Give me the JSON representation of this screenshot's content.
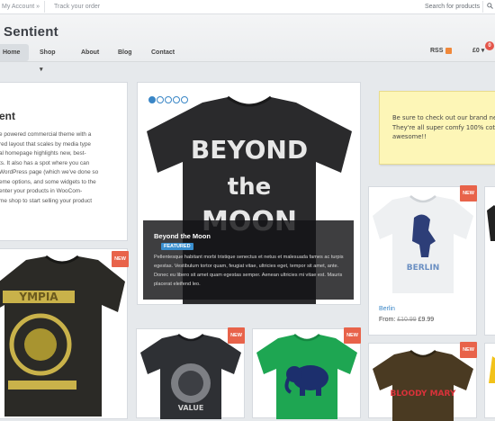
{
  "topbar": {
    "account": "My Account »",
    "track_order": "Track your order",
    "search_placeholder": "Search for products"
  },
  "header": {
    "logo": "Sentient",
    "nav": [
      {
        "label": "Home"
      },
      {
        "label": "Shop ▾"
      },
      {
        "label": "About"
      },
      {
        "label": "Blog"
      },
      {
        "label": "Contact"
      }
    ],
    "rss_label": "RSS",
    "cart_amount": "£0 ▾",
    "cart_count": "0"
  },
  "welcome": {
    "heading": "ent",
    "body": "e powered commercial theme with a\nred layout that scales by media type\nal homepage highlights new, best-\nts. It also has a spot where you can\nWordPress page (which we've done so\neme options, and some widgets to the\nenter your products in WooCom-\nme shop to start selling your product"
  },
  "featured": {
    "slide_count": 5,
    "active_slide": 1,
    "shirt_text": [
      "BEYOND",
      "the",
      "MOON"
    ],
    "title": "Beyond the Moon",
    "badge": "FEATURED",
    "text": "Pellentesque habitant morbi tristique senectus et netus et malesuada fames ac turpis egestas. Vestibulum tortor quam, feugiat vitae, ultricies eget, tempor sit amet, ante. Donec eu libero sit amet quam egestas semper. Aenean ultricies mi vitae est. Mauris placerat eleifend leo."
  },
  "note": {
    "text": "Be sure to check out our brand new\nThey're all super comfy 100% cotton\nawesome!!"
  },
  "products": {
    "new_label": "NEW",
    "berlin": {
      "name": "Berlin",
      "price_prefix": "From:",
      "old_price": "£10.99",
      "price": "£9.99",
      "shirt_text": "BERLIN"
    },
    "olympia_text": "YMPIA",
    "grateful_text": "VALUE",
    "bloody_text": "BLOODY MARY"
  },
  "colors": {
    "accent": "#3a86c6",
    "new_badge": "#e8634a",
    "cart_badge": "#e4554a",
    "note_bg": "#fdf6b7"
  }
}
